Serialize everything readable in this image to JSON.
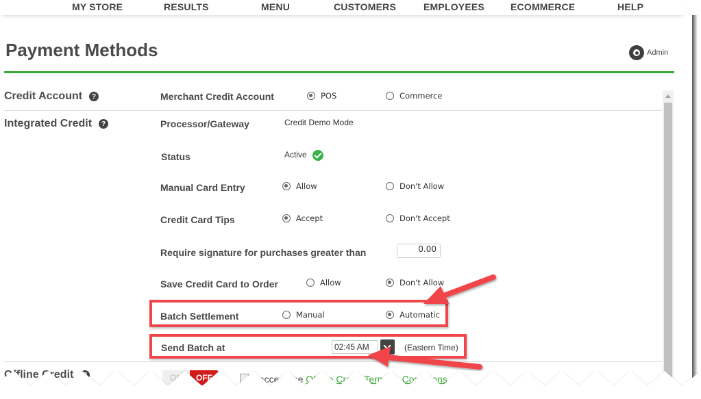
{
  "topnav": {
    "items": [
      "MY STORE",
      "RESULTS",
      "MENU",
      "CUSTOMERS",
      "EMPLOYEES",
      "ECOMMERCE",
      "HELP"
    ]
  },
  "page": {
    "title": "Payment Methods",
    "admin_label": "Admin"
  },
  "sections": {
    "credit_account": {
      "label": "Credit Account",
      "help": "?",
      "merchant_label": "Merchant Credit Account",
      "options": [
        "POS",
        "Commerce"
      ],
      "selected": "POS"
    },
    "integrated_credit": {
      "label": "Integrated Credit",
      "help": "?",
      "processor_label": "Processor/Gateway",
      "processor_value": "Credit Demo Mode",
      "status_label": "Status",
      "status_value": "Active",
      "manual_entry": {
        "label": "Manual Card Entry",
        "options": [
          "Allow",
          "Don't Allow"
        ],
        "selected": "Allow"
      },
      "tips": {
        "label": "Credit Card Tips",
        "options": [
          "Accept",
          "Don't Accept"
        ],
        "selected": "Accept"
      },
      "signature": {
        "label": "Require signature for purchases greater than",
        "value": "0.00"
      },
      "save_card": {
        "label": "Save Credit Card to Order",
        "options": [
          "Allow",
          "Don't Allow"
        ],
        "selected": "Don't Allow"
      },
      "batch_settlement": {
        "label": "Batch Settlement",
        "options": [
          "Manual",
          "Automatic"
        ],
        "selected": "Automatic"
      },
      "send_batch": {
        "label": "Send Batch at",
        "time": "02:45 AM",
        "timezone": "(Eastern Time)"
      }
    },
    "offline_credit": {
      "label": "Offline Credit",
      "toggle_on": "ON",
      "toggle_off": "OFF",
      "toggle_state": "OFF",
      "accept_prefix": "I accept the ",
      "terms_link": "Offline Credit Terms & Conditions."
    }
  },
  "colors": {
    "accent_green": "#39a935",
    "annotation_red": "#f0454a",
    "toggle_off_red": "#d21b1b"
  }
}
